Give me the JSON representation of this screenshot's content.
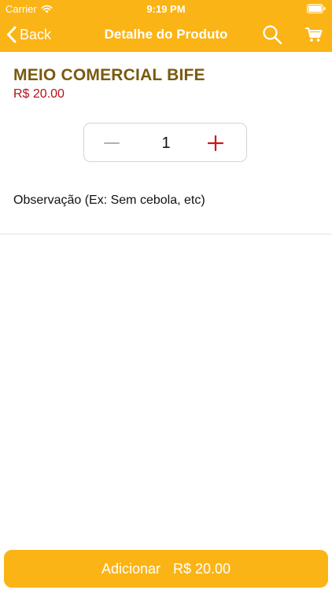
{
  "status_bar": {
    "carrier": "Carrier",
    "time": "9:19 PM"
  },
  "nav": {
    "back_label": "Back",
    "title": "Detalhe do Produto"
  },
  "product": {
    "name": "MEIO COMERCIAL BIFE",
    "price": "R$ 20.00"
  },
  "quantity": {
    "value": "1"
  },
  "note": {
    "placeholder": "Observação (Ex: Sem cebola, etc)"
  },
  "footer": {
    "add_label": "Adicionar",
    "total": "R$ 20.00"
  },
  "colors": {
    "brand": "#fbb416",
    "product_name": "#7a5a10",
    "price": "#b3121a",
    "plus": "#d0121b",
    "minus": "#b0b0b0"
  },
  "icons": {
    "wifi": "wifi-icon",
    "battery": "battery-icon",
    "back": "chevron-left-icon",
    "search": "search-icon",
    "cart": "cart-icon",
    "minus": "minus-icon",
    "plus": "plus-icon"
  }
}
